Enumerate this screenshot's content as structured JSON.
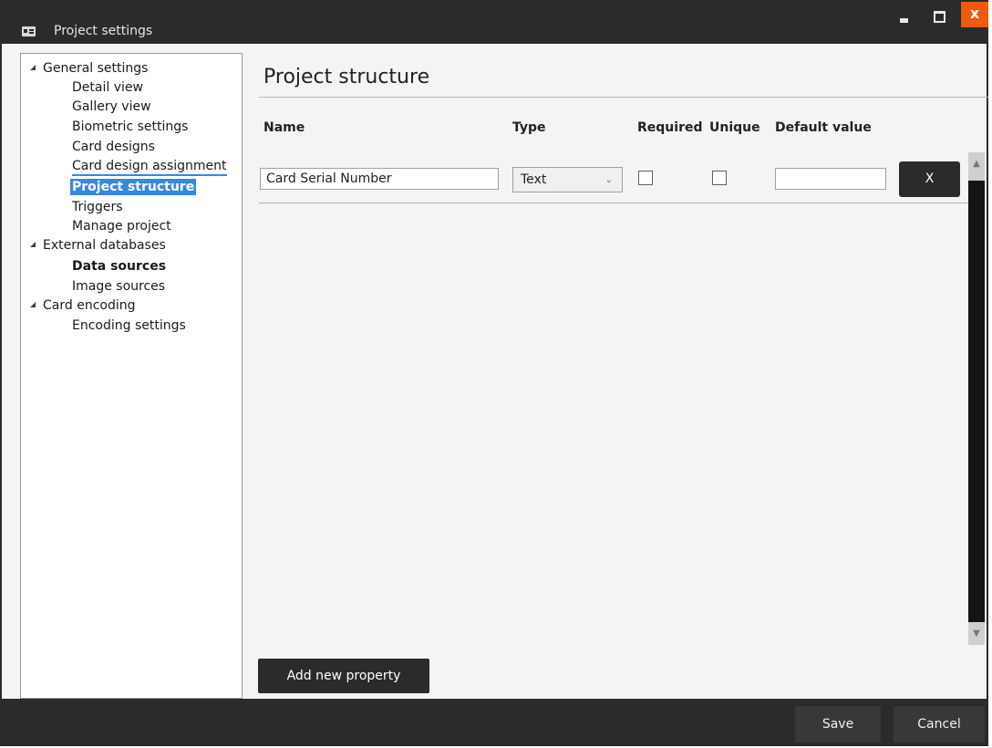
{
  "window": {
    "title": "Project settings",
    "close_label": "x"
  },
  "tree": {
    "groups": [
      {
        "label": "General settings",
        "items": [
          "Detail view",
          "Gallery view",
          "Biometric settings",
          "Card designs",
          "Card design assignment",
          "Project structure",
          "Triggers",
          "Manage project"
        ]
      },
      {
        "label": "External databases",
        "items": [
          "Data sources",
          "Image sources"
        ]
      },
      {
        "label": "Card encoding",
        "items": [
          "Encoding settings"
        ]
      }
    ],
    "selected": "Project structure"
  },
  "main": {
    "title": "Project structure",
    "columns": {
      "name": "Name",
      "type": "Type",
      "required": "Required",
      "unique": "Unique",
      "default_value": "Default value"
    },
    "rows": [
      {
        "name": "Card Serial Number",
        "type": "Text",
        "required": false,
        "unique": false,
        "default_value": "",
        "delete_label": "X"
      }
    ],
    "add_button": "Add new property"
  },
  "footer": {
    "save": "Save",
    "cancel": "Cancel"
  },
  "colors": {
    "dark": "#2b2b2b",
    "selection": "#3a86e0",
    "close": "#ee5a12"
  }
}
